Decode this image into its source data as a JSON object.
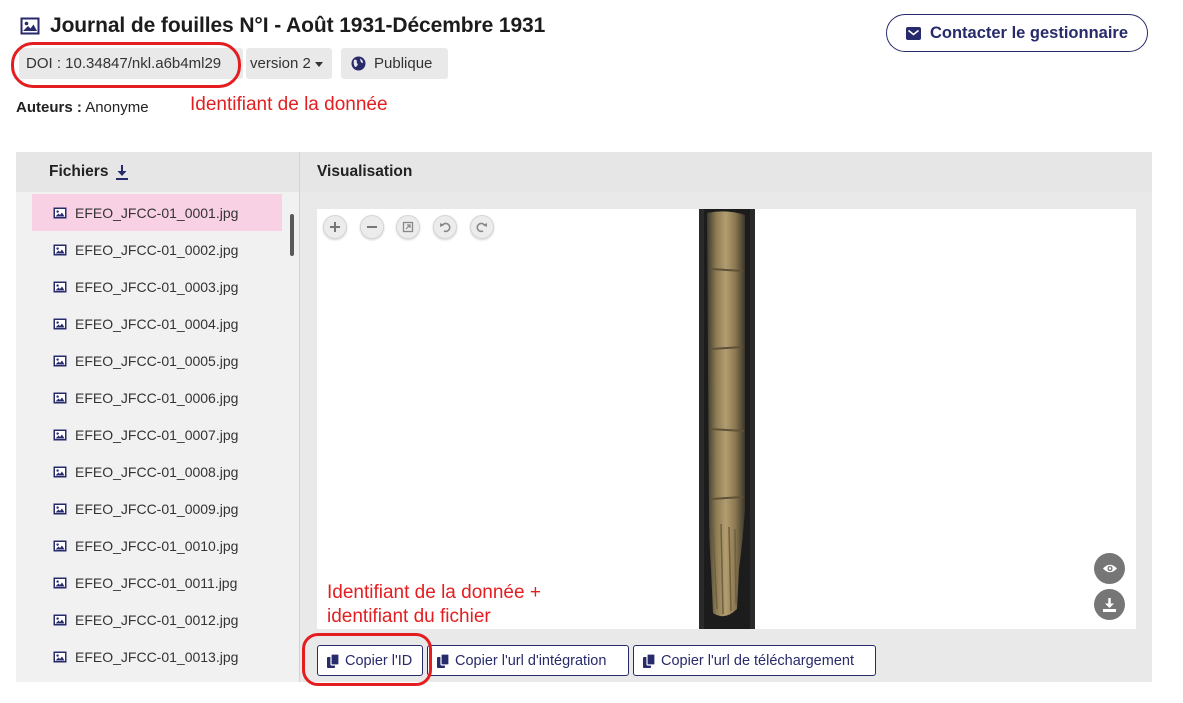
{
  "header": {
    "title": "Journal de fouilles N°I - Août 1931-Décembre 1931",
    "contact_label": "Contacter le gestionnaire",
    "doi": "DOI : 10.34847/nkl.a6b4ml29",
    "version": "version 2",
    "visibility": "Publique"
  },
  "authors": {
    "label": "Auteurs :",
    "value": "Anonyme"
  },
  "annotations": {
    "data_id": "Identifiant de la donnée",
    "file_id_line1": "Identifiant de la donnée +",
    "file_id_line2": "identifiant du fichier",
    "color": "#e41e20"
  },
  "files": {
    "title": "Fichiers",
    "items": [
      "EFEO_JFCC-01_0001.jpg",
      "EFEO_JFCC-01_0002.jpg",
      "EFEO_JFCC-01_0003.jpg",
      "EFEO_JFCC-01_0004.jpg",
      "EFEO_JFCC-01_0005.jpg",
      "EFEO_JFCC-01_0006.jpg",
      "EFEO_JFCC-01_0007.jpg",
      "EFEO_JFCC-01_0008.jpg",
      "EFEO_JFCC-01_0009.jpg",
      "EFEO_JFCC-01_0010.jpg",
      "EFEO_JFCC-01_0011.jpg",
      "EFEO_JFCC-01_0012.jpg",
      "EFEO_JFCC-01_0013.jpg"
    ],
    "selected_index": 0
  },
  "viewer": {
    "title": "Visualisation",
    "controls": [
      "zoom-in-icon",
      "zoom-out-icon",
      "fit-screen-icon",
      "rotate-left-icon",
      "rotate-right-icon"
    ]
  },
  "actions": {
    "copy_id": "Copier l'ID",
    "copy_embed_url": "Copier l'url d'intégration",
    "copy_download_url": "Copier l'url de téléchargement"
  },
  "colors": {
    "primary": "#272a6b",
    "selected_row": "#f9d1e4",
    "panel": "#e9e9e9"
  }
}
